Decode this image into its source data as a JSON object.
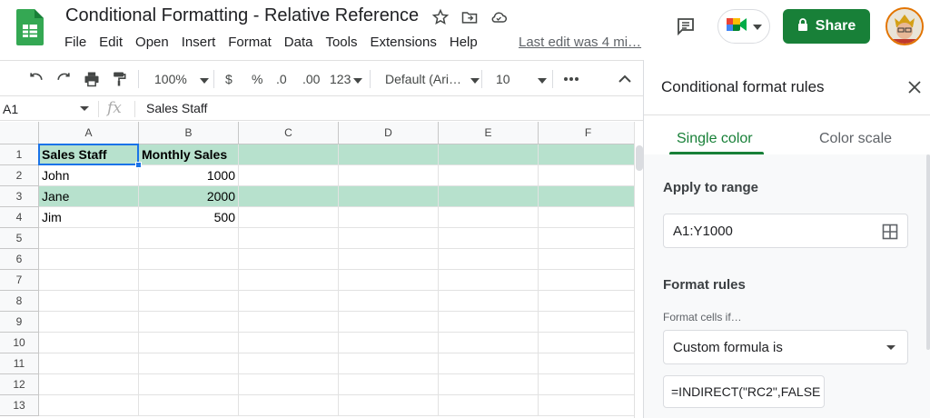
{
  "document": {
    "title": "Conditional Formatting - Relative Reference",
    "last_edit": "Last edit was 4 mi…"
  },
  "menu": [
    "File",
    "Edit",
    "Open",
    "Insert",
    "Format",
    "Data",
    "Tools",
    "Extensions",
    "Help"
  ],
  "header": {
    "share_label": "Share",
    "icons": [
      "star-icon",
      "move-to-folder-icon",
      "cloud-saved-icon",
      "comment-icon",
      "meet-icon",
      "lock-icon",
      "avatar"
    ]
  },
  "toolbar": {
    "zoom": "100%",
    "currency": "$",
    "percent": "%",
    "decrease_decimal": ".0",
    "increase_decimal": ".00",
    "more_formats": "123",
    "font": "Default (Ari…",
    "font_size": "10"
  },
  "formula_bar": {
    "name_box": "A1",
    "fx": "fx",
    "content": "Sales Staff"
  },
  "grid": {
    "columns": [
      "A",
      "B",
      "C",
      "D",
      "E",
      "F"
    ],
    "rows": [
      "1",
      "2",
      "3",
      "4",
      "5",
      "6",
      "7",
      "8",
      "9",
      "10",
      "11",
      "12",
      "13"
    ],
    "cells": {
      "A1": "Sales Staff",
      "B1": "Monthly Sales",
      "A2": "John",
      "B2": "1000",
      "A3": "Jane",
      "B3": "2000",
      "A4": "Jim",
      "B4": "500"
    },
    "highlighted_rows": [
      1,
      3
    ],
    "highlight_color": "#b7e1cd"
  },
  "panel": {
    "title": "Conditional format rules",
    "tabs": [
      "Single color",
      "Color scale"
    ],
    "active_tab": "Single color",
    "apply_to_range_label": "Apply to range",
    "range": "A1:Y1000",
    "format_rules_label": "Format rules",
    "format_cells_if_label": "Format cells if…",
    "condition": "Custom formula is",
    "formula": "=INDIRECT(\"RC2\",FALSE"
  },
  "colors": {
    "accent": "#188038",
    "selection": "#1a73e8"
  }
}
